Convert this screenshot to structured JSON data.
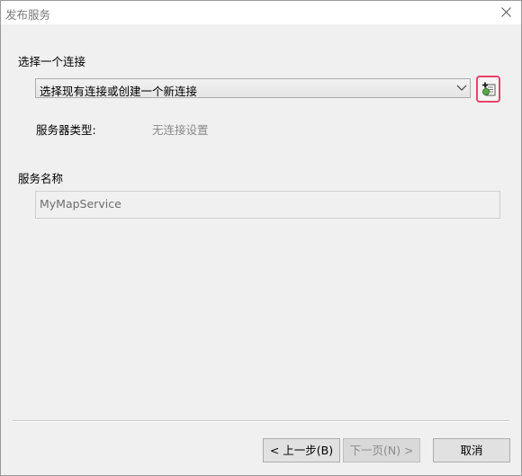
{
  "window": {
    "title": "发布服务",
    "close_icon": "close-icon"
  },
  "connection": {
    "label": "选择一个连接",
    "selected": "选择现有连接或创建一个新连接",
    "add_button_icon": "add-server-connection-icon",
    "highlight_color": "#e8436b"
  },
  "server_type": {
    "label": "服务器类型:",
    "value": "无连接设置"
  },
  "service_name": {
    "label": "服务名称",
    "value": "MyMapService"
  },
  "buttons": {
    "back": "< 上一步(B)",
    "next": "下一页(N) >",
    "cancel": "取消"
  }
}
